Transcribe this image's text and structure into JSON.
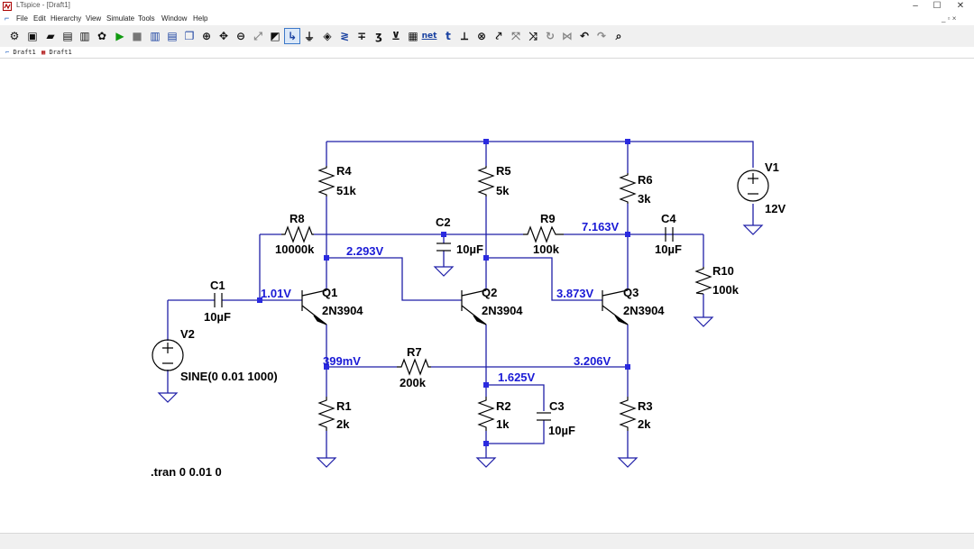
{
  "window": {
    "title": "LTspice - [Draft1]",
    "min": "–",
    "max": "☐",
    "close": "✕"
  },
  "menu": {
    "items": [
      "File",
      "Edit",
      "Hierarchy",
      "View",
      "Simulate",
      "Tools",
      "Window",
      "Help"
    ],
    "mdi_controls": "_ ▫ ×"
  },
  "toolbar": {
    "net_label": "net",
    "t_label": "t"
  },
  "tabs": [
    {
      "label": "Draft1"
    },
    {
      "label": "Draft1"
    }
  ],
  "schematic": {
    "components": {
      "R4": {
        "name": "R4",
        "value": "51k"
      },
      "R5": {
        "name": "R5",
        "value": "5k"
      },
      "R6": {
        "name": "R6",
        "value": "3k"
      },
      "R8": {
        "name": "R8",
        "value": "10000k"
      },
      "R9": {
        "name": "R9",
        "value": "100k"
      },
      "R10": {
        "name": "R10",
        "value": "100k"
      },
      "R7": {
        "name": "R7",
        "value": "200k"
      },
      "R1": {
        "name": "R1",
        "value": "2k"
      },
      "R2": {
        "name": "R2",
        "value": "1k"
      },
      "R3": {
        "name": "R3",
        "value": "2k"
      },
      "C1": {
        "name": "C1",
        "value": "10µF"
      },
      "C2": {
        "name": "C2",
        "value": "10µF"
      },
      "C3": {
        "name": "C3",
        "value": "10µF"
      },
      "C4": {
        "name": "C4",
        "value": "10µF"
      },
      "Q1": {
        "name": "Q1",
        "value": "2N3904"
      },
      "Q2": {
        "name": "Q2",
        "value": "2N3904"
      },
      "Q3": {
        "name": "Q3",
        "value": "2N3904"
      },
      "V1": {
        "name": "V1",
        "value": "12V"
      },
      "V2": {
        "name": "V2",
        "value": "SINE(0 0.01 1000)"
      }
    },
    "node_voltages": {
      "q1_base": "1.01V",
      "q1_collector": "2.293V",
      "q1_emitter": "399mV",
      "q3_base": "3.873V",
      "q3_collector": "7.163V",
      "q3_emitter": "3.206V",
      "q2_emitter": "1.625V"
    },
    "directive": ".tran 0 0.01 0"
  },
  "colors": {
    "wire": "#1f1fa8",
    "component": "#000000",
    "voltage_label": "#1a1ad6",
    "node_dot": "#2a2ae0"
  }
}
